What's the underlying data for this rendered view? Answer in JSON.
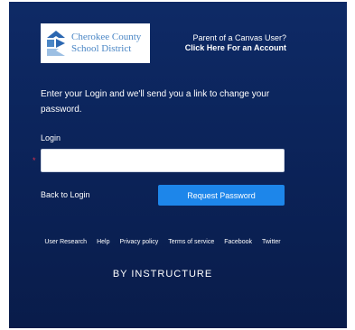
{
  "logo": {
    "line1": "Cherokee County",
    "line2": "School District"
  },
  "parent_prompt": {
    "question": "Parent of a Canvas User?",
    "link": "Click Here For an Account"
  },
  "instructions": "Enter your Login and we'll send you a link to change your password.",
  "login": {
    "label": "Login",
    "required_marker": "*",
    "value": "",
    "placeholder": ""
  },
  "back_to_login": "Back to Login",
  "request_password": "Request Password",
  "footer_links": [
    "User Research",
    "Help",
    "Privacy policy",
    "Terms of service",
    "Facebook",
    "Twitter"
  ],
  "brand": "BY INSTRUCTURE",
  "colors": {
    "panel": "#0b2257",
    "button": "#1d86ea",
    "logo_text": "#4a86c5",
    "required": "#e0324b"
  },
  "icons": {
    "logo_mark": "cherokee-county-logo-icon"
  }
}
